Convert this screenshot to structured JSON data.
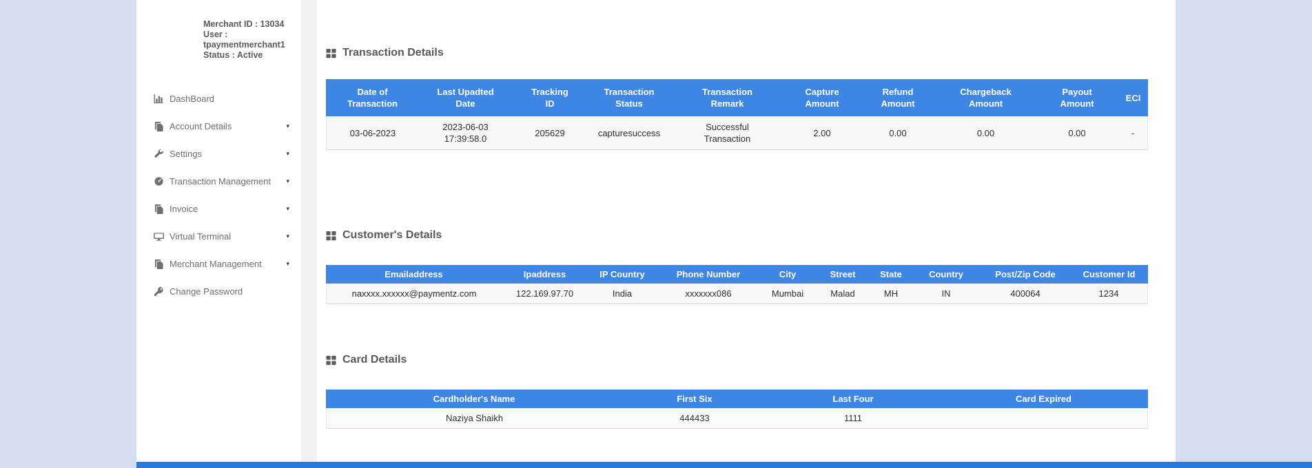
{
  "colors": {
    "page_background": "#d5def1",
    "table_header_blue": "#3d86e4",
    "footer_bar_blue": "#2878dd",
    "row_background": "#f7f7f7"
  },
  "sidebar": {
    "merchant_info": {
      "merchant_id": "Merchant ID : 13034",
      "user_label": "User :",
      "user_name": "tpaymentmerchant1",
      "status": "Status : Active"
    },
    "items": [
      {
        "label": "DashBoard",
        "icon": "bar-chart-icon",
        "has_submenu": false
      },
      {
        "label": "Account Details",
        "icon": "file-copy-icon",
        "has_submenu": true
      },
      {
        "label": "Settings",
        "icon": "wrench-icon",
        "has_submenu": true
      },
      {
        "label": "Transaction Management",
        "icon": "gauge-icon",
        "has_submenu": true
      },
      {
        "label": "Invoice",
        "icon": "file-copy-icon",
        "has_submenu": true
      },
      {
        "label": "Virtual Terminal",
        "icon": "desktop-icon",
        "has_submenu": true
      },
      {
        "label": "Merchant Management",
        "icon": "file-copy-icon",
        "has_submenu": true
      },
      {
        "label": "Change Password",
        "icon": "key-icon",
        "has_submenu": false
      }
    ],
    "chevron_glyph": "▾"
  },
  "sections": {
    "transaction": {
      "title": "Transaction Details",
      "columns": [
        "Date of\nTransaction",
        "Last Upadted\nDate",
        "Tracking\nID",
        "Transaction\nStatus",
        "Transaction\nRemark",
        "Capture\nAmount",
        "Refund\nAmount",
        "Chargeback\nAmount",
        "Payout\nAmount",
        "ECI"
      ],
      "row": [
        "03-06-2023",
        "2023-06-03\n17:39:58.0",
        "205629",
        "capturesuccess",
        "Successful\nTransaction",
        "2.00",
        "0.00",
        "0.00",
        "0.00",
        "-"
      ]
    },
    "customer": {
      "title": "Customer's Details",
      "columns": [
        "Emailaddress",
        "Ipaddress",
        "IP Country",
        "Phone Number",
        "City",
        "Street",
        "State",
        "Country",
        "Post/Zip Code",
        "Customer Id"
      ],
      "row": [
        "naxxxx.xxxxxx@paymentz.com",
        "122.169.97.70",
        "India",
        "xxxxxxx086",
        "Mumbai",
        "Malad",
        "MH",
        "IN",
        "400064",
        "1234"
      ]
    },
    "card": {
      "title": "Card Details",
      "columns": [
        "Cardholder's Name",
        "First Six",
        "Last Four",
        "Card Expired"
      ],
      "row": [
        "Naziya Shaikh",
        "444433",
        "1111",
        ""
      ]
    }
  }
}
